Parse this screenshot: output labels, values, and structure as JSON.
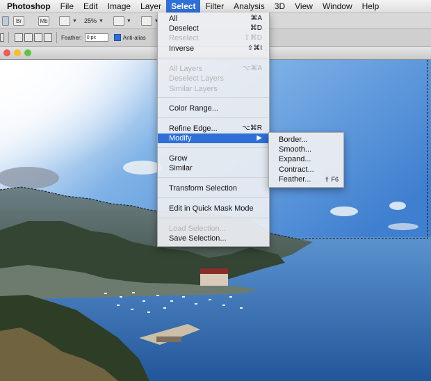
{
  "menubar": {
    "app": "Photoshop",
    "items": [
      "File",
      "Edit",
      "Image",
      "Layer",
      "Select",
      "Filter",
      "Analysis",
      "3D",
      "View",
      "Window",
      "Help"
    ]
  },
  "appbar": {
    "br_label": "Br",
    "mb_label": "Mb",
    "zoom": "25%"
  },
  "options": {
    "feather_label": "Feather:",
    "feather_value": "0 px",
    "antialias_label": "Anti-alias"
  },
  "document": {
    "title_fragment": "*"
  },
  "select_menu": {
    "items": [
      {
        "label": "All",
        "shortcut": "⌘A",
        "enabled": true
      },
      {
        "label": "Deselect",
        "shortcut": "⌘D",
        "enabled": true
      },
      {
        "label": "Reselect",
        "shortcut": "⇧⌘D",
        "enabled": false
      },
      {
        "label": "Inverse",
        "shortcut": "⇧⌘I",
        "enabled": true
      },
      {
        "label": "All Layers",
        "shortcut": "⌥⌘A",
        "enabled": false
      },
      {
        "label": "Deselect Layers",
        "shortcut": "",
        "enabled": false
      },
      {
        "label": "Similar Layers",
        "shortcut": "",
        "enabled": false
      },
      {
        "label": "Color Range...",
        "shortcut": "",
        "enabled": true
      },
      {
        "label": "Refine Edge...",
        "shortcut": "⌥⌘R",
        "enabled": true
      },
      {
        "label": "Modify",
        "shortcut": "▶",
        "enabled": true,
        "highlighted": true
      },
      {
        "label": "Grow",
        "shortcut": "",
        "enabled": true
      },
      {
        "label": "Similar",
        "shortcut": "",
        "enabled": true
      },
      {
        "label": "Transform Selection",
        "shortcut": "",
        "enabled": true
      },
      {
        "label": "Edit in Quick Mask Mode",
        "shortcut": "",
        "enabled": true
      },
      {
        "label": "Load Selection...",
        "shortcut": "",
        "enabled": false
      },
      {
        "label": "Save Selection...",
        "shortcut": "",
        "enabled": true
      }
    ]
  },
  "modify_submenu": {
    "items": [
      {
        "label": "Border...",
        "shortcut": ""
      },
      {
        "label": "Smooth...",
        "shortcut": ""
      },
      {
        "label": "Expand...",
        "shortcut": ""
      },
      {
        "label": "Contract...",
        "shortcut": ""
      },
      {
        "label": "Feather...",
        "shortcut": "⇧ F6"
      }
    ]
  },
  "colors": {
    "highlight": "#2f6fd6",
    "sky": "#6aa3e0",
    "sea": "#2f6db0"
  }
}
